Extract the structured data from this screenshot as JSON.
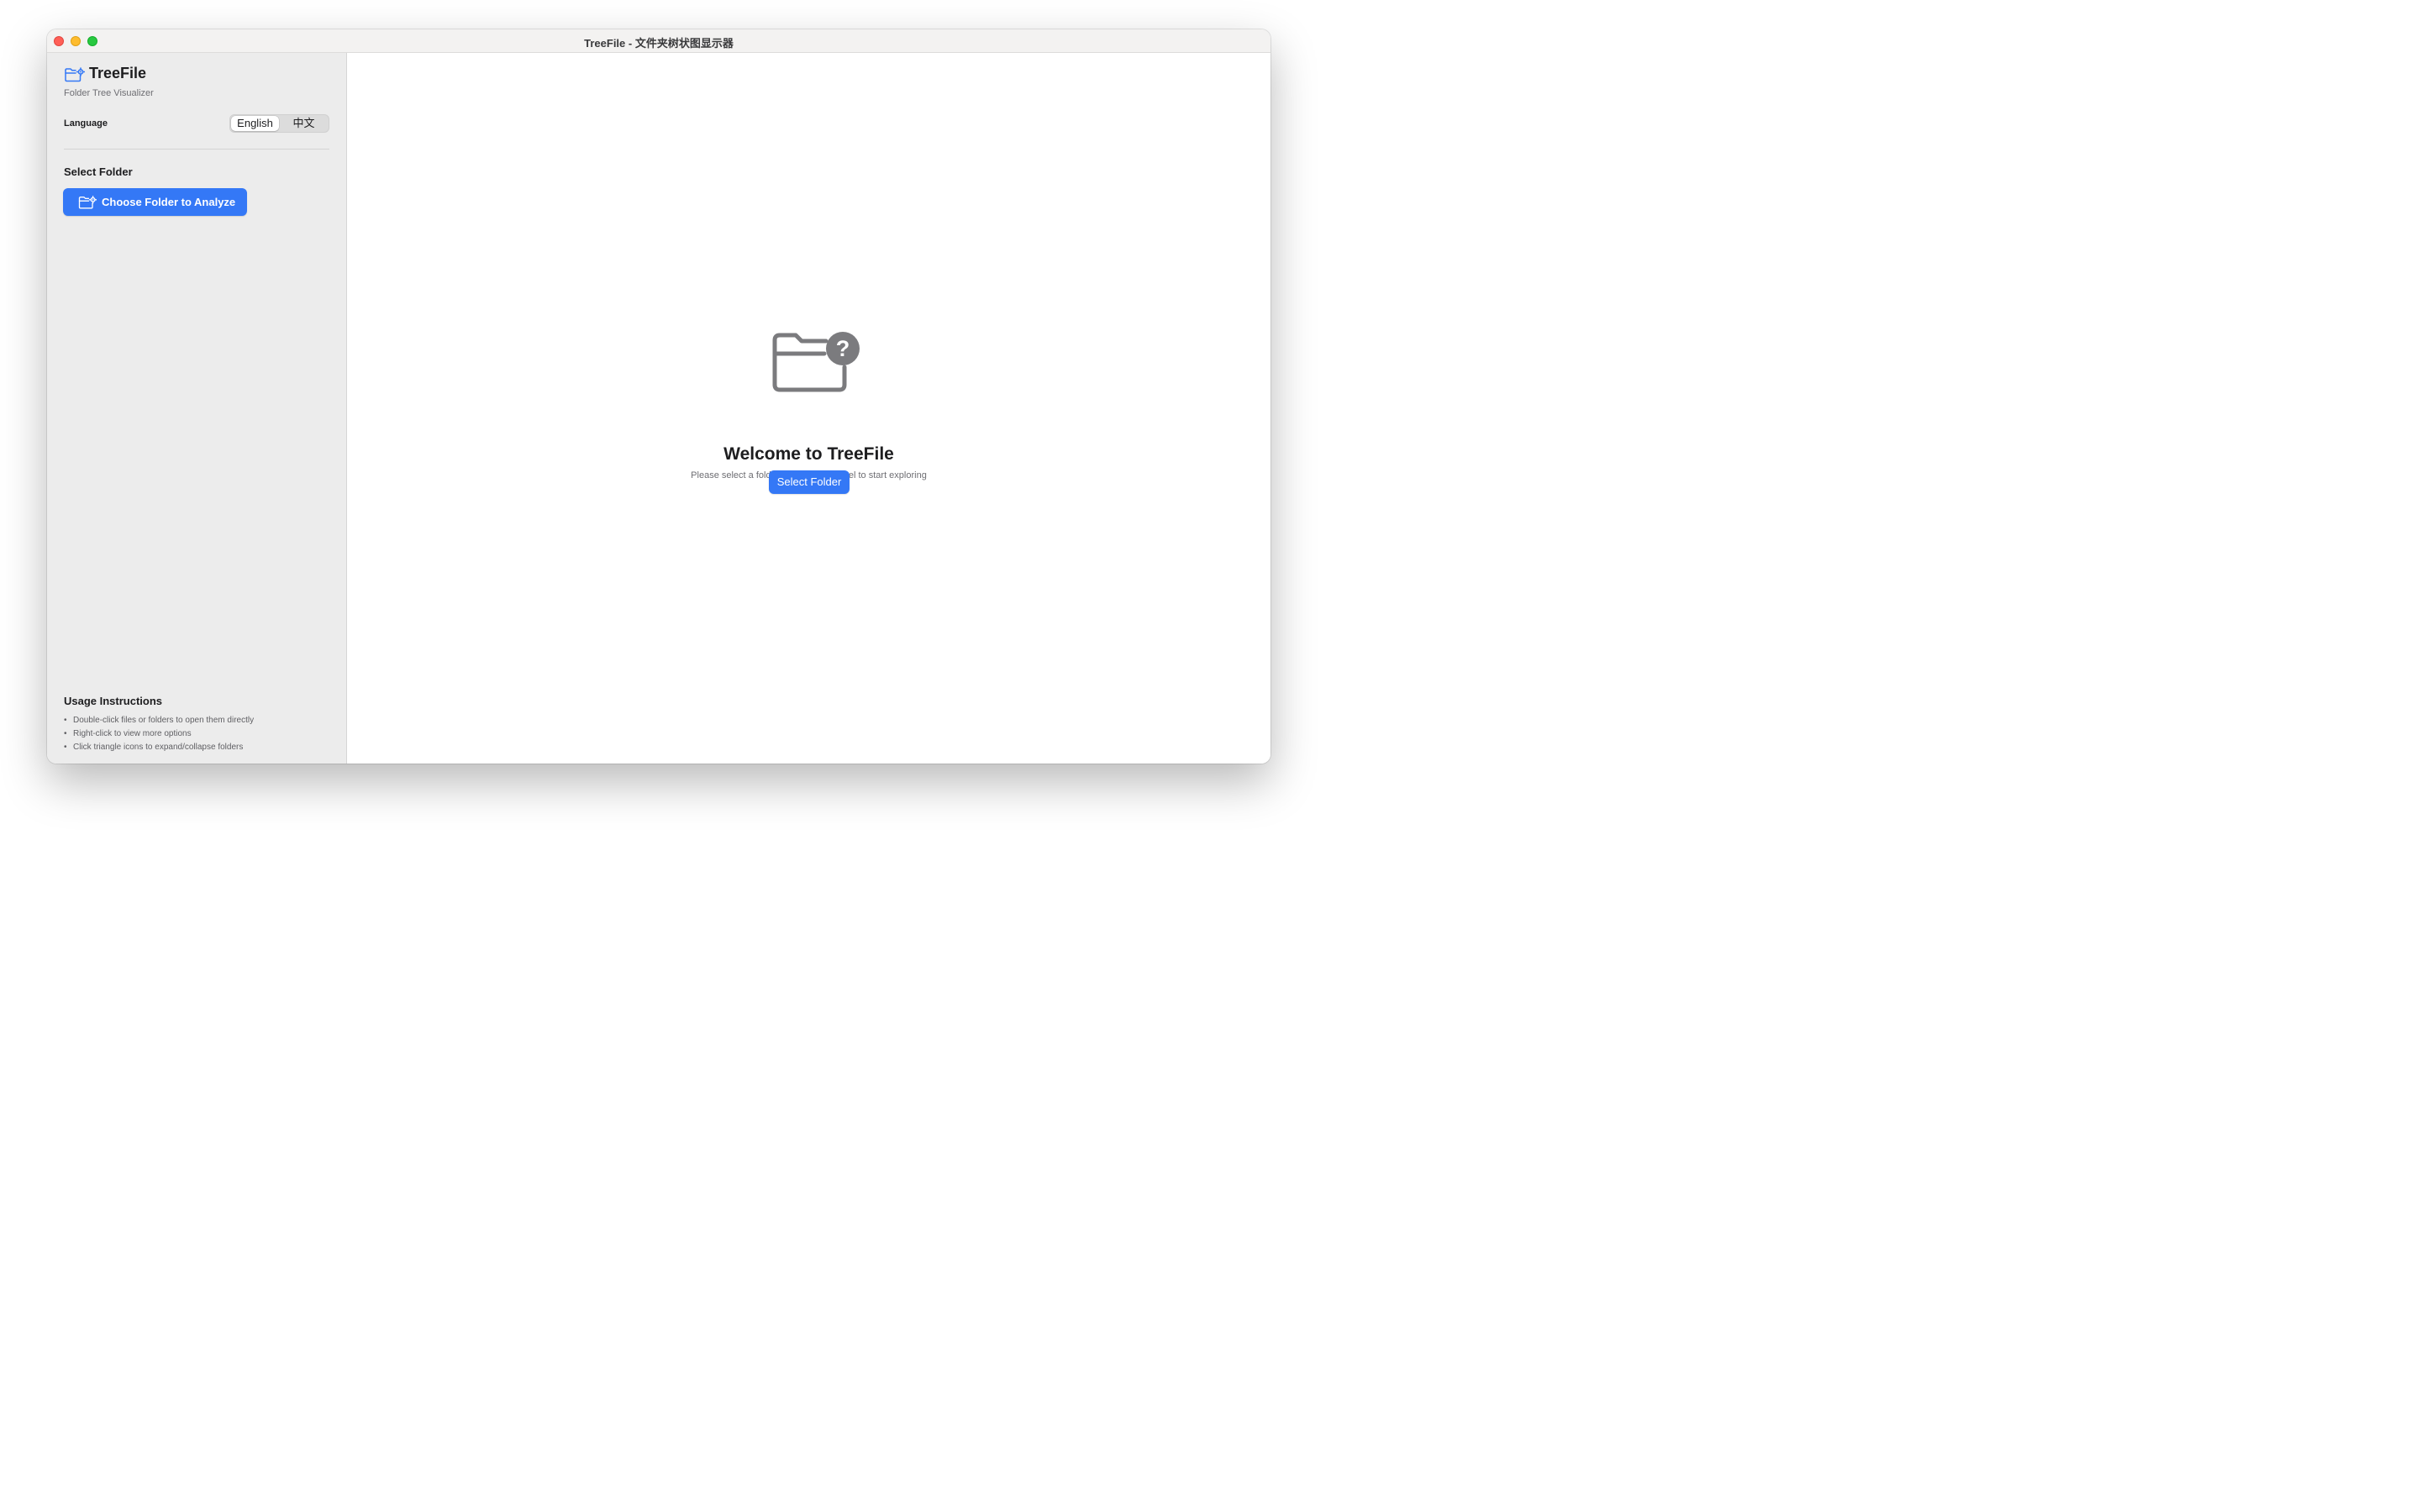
{
  "window": {
    "title": "TreeFile - 文件夹树状图显示器"
  },
  "sidebar": {
    "app_name": "TreeFile",
    "app_subtitle": "Folder Tree Visualizer",
    "brand_icon": "folder-gear-icon",
    "language": {
      "label": "Language",
      "options": [
        "English",
        "中文"
      ],
      "selected": "English"
    },
    "select_section": {
      "title": "Select Folder",
      "choose_button_label": "Choose Folder to Analyze",
      "choose_button_icon": "folder-gear-icon"
    },
    "usage": {
      "title": "Usage Instructions",
      "bullet": "•",
      "items": [
        "Double-click files or folders to open them directly",
        "Right-click to view more options",
        "Click triangle icons to expand/collapse folders"
      ]
    }
  },
  "main": {
    "empty_icon": "folder-question-icon",
    "welcome_title": "Welcome to TreeFile",
    "welcome_subtitle": "Please select a folder from the left panel to start exploring",
    "select_button_label": "Select Folder"
  },
  "colors": {
    "accent": "#3478f6",
    "sidebar_bg": "#ececec",
    "close": "#ff5f57",
    "minimize": "#febc2e",
    "maximize": "#28c840"
  }
}
